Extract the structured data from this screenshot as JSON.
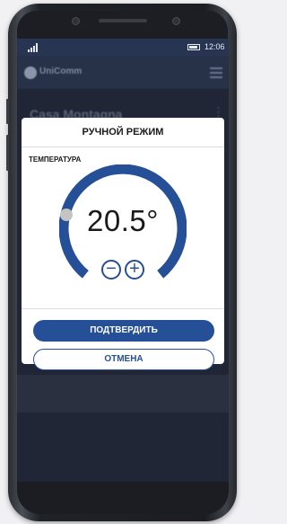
{
  "status_bar": {
    "time": "12:06"
  },
  "app_bar": {
    "brand": "UniComm"
  },
  "background": {
    "title": "Casa Montagna",
    "more_glyph": "⋮"
  },
  "modal": {
    "title": "РУЧНОЙ РЕЖИМ",
    "temperature_label": "ТЕМПЕРАТУРА",
    "temperature_value": "20.5°",
    "decrease_glyph": "−",
    "increase_glyph": "+",
    "confirm_label": "ПОДТВЕРДИТЬ",
    "cancel_label": "ОТМЕНА"
  },
  "colors": {
    "accent": "#254f96",
    "screen_bg": "#1f2533",
    "modal_bg": "#ffffff",
    "knob": "#c4c4c4"
  }
}
